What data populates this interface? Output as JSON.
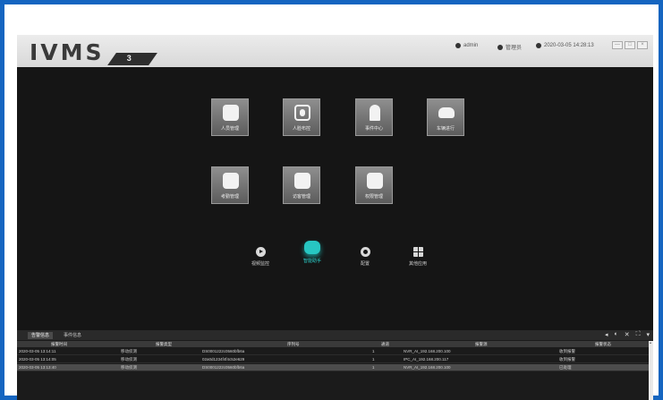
{
  "app": {
    "logo_text": "IVMS",
    "logo_badge": "3"
  },
  "titlebar": {
    "user": "admin",
    "role": "管理员",
    "datetime": "2020-03-05 14:28:13",
    "window_buttons": [
      "—",
      "□",
      "×"
    ]
  },
  "tiles_row1": [
    {
      "label": "人员管理",
      "icon": "person-icon"
    },
    {
      "label": "人脸布控",
      "icon": "face-scan-icon"
    },
    {
      "label": "事件中心",
      "icon": "alarm-light-icon"
    },
    {
      "label": "车辆进行",
      "icon": "car-icon"
    }
  ],
  "tiles_row2": [
    {
      "label": "考勤管理",
      "icon": "calendar-icon"
    },
    {
      "label": "访客管理",
      "icon": "building-icon"
    },
    {
      "label": "权限管理",
      "icon": "id-card-icon"
    }
  ],
  "bottom_apps": [
    {
      "label": "视频监控",
      "icon": "play-icon"
    },
    {
      "label": "智能助手",
      "icon": "robot-icon",
      "active": true
    },
    {
      "label": "配置",
      "icon": "gear-icon"
    },
    {
      "label": "其他应用",
      "icon": "apps-grid-icon"
    }
  ],
  "panel": {
    "tabs": [
      "告警信息",
      "事件信息"
    ],
    "tools": [
      "◂",
      "◐",
      "✕",
      "⛶",
      "▾"
    ],
    "columns": [
      "报警时间",
      "报警类型",
      "序列号",
      "通道",
      "报警源",
      "报警状态"
    ],
    "rows": [
      [
        "2020-03-05 13:14:11",
        "移动侦测",
        "DS0001222c0560bfb6a",
        "1",
        "NVR_AI_192.168.200.100",
        "收到报警"
      ],
      [
        "2020-03-05 13:14:05",
        "移动侦测",
        "02a0d1234f4f4c52e629",
        "1",
        "IPC_AI_192.168.200.117",
        "收到报警"
      ],
      [
        "2020-03-05 13:13:40",
        "移动侦测",
        "DS0001222c0560bfb6a",
        "1",
        "NVR_AI_192.168.200.100",
        "已处理"
      ]
    ]
  },
  "colors": {
    "border_blue": "#1565c0",
    "app_bg": "#151515",
    "accent_teal": "#27c6c2"
  }
}
